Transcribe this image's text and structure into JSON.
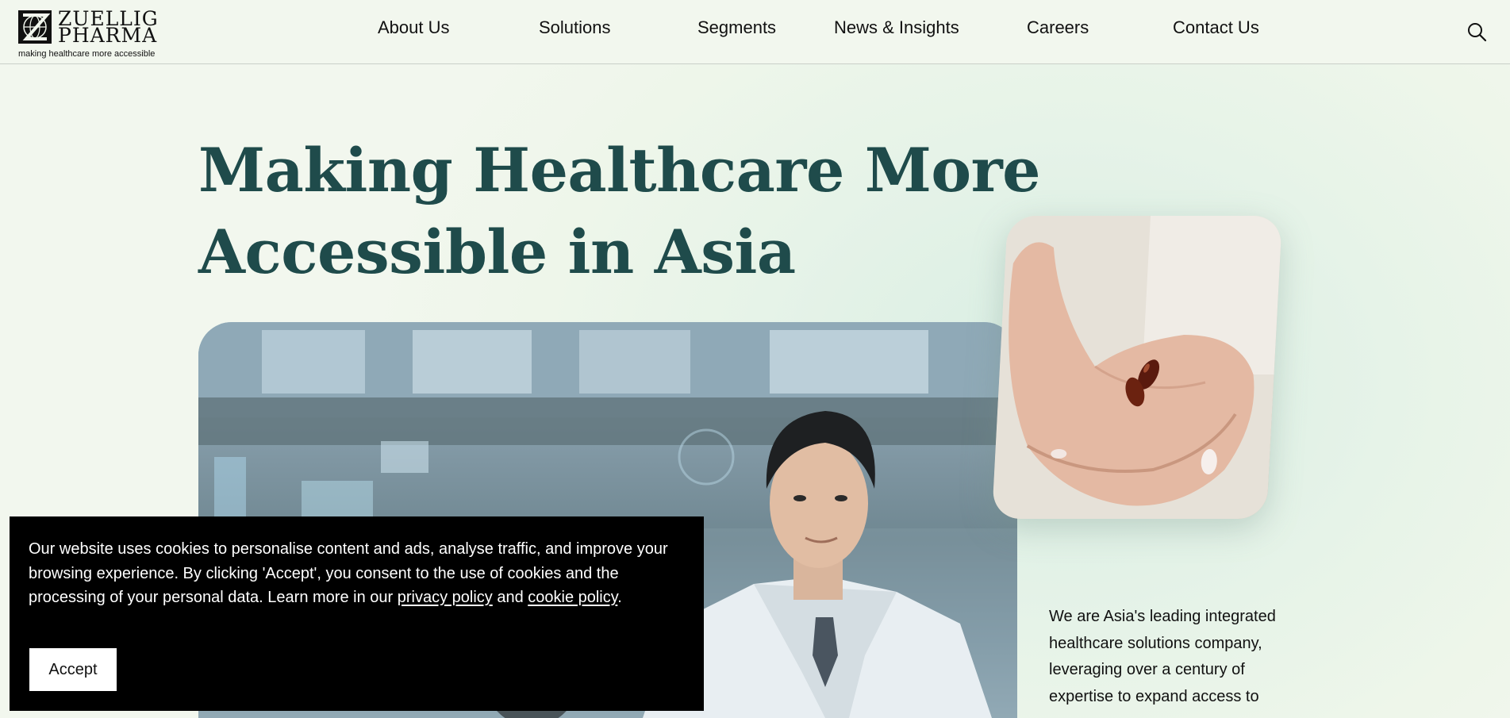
{
  "header": {
    "logo_name": "ZUELLIG\nPHARMA",
    "logo_tagline": "making healthcare more accessible",
    "nav": [
      {
        "label": "About Us"
      },
      {
        "label": "Solutions"
      },
      {
        "label": "Segments"
      },
      {
        "label": "News & Insights"
      },
      {
        "label": "Careers"
      },
      {
        "label": "Contact Us"
      }
    ],
    "search_icon": "search-icon"
  },
  "hero": {
    "title_line1": "Making Healthcare More",
    "title_line2": "Accessible in Asia",
    "intro": "We are Asia's leading integrated healthcare solutions company, leveraging over a century of expertise to expand access to"
  },
  "cookie": {
    "text_before": "Our website uses cookies to personalise content and ads, analyse traffic, and improve your browsing experience. By clicking 'Accept', you consent to the use of cookies and the processing of your personal data. Learn more in our ",
    "privacy_link": "privacy policy",
    "and": " and ",
    "cookie_link": "cookie policy",
    "period": ".",
    "accept_label": "Accept"
  },
  "colors": {
    "title": "#1f4b4b",
    "background": "#eef6ea",
    "cookie_bg": "#000000"
  }
}
